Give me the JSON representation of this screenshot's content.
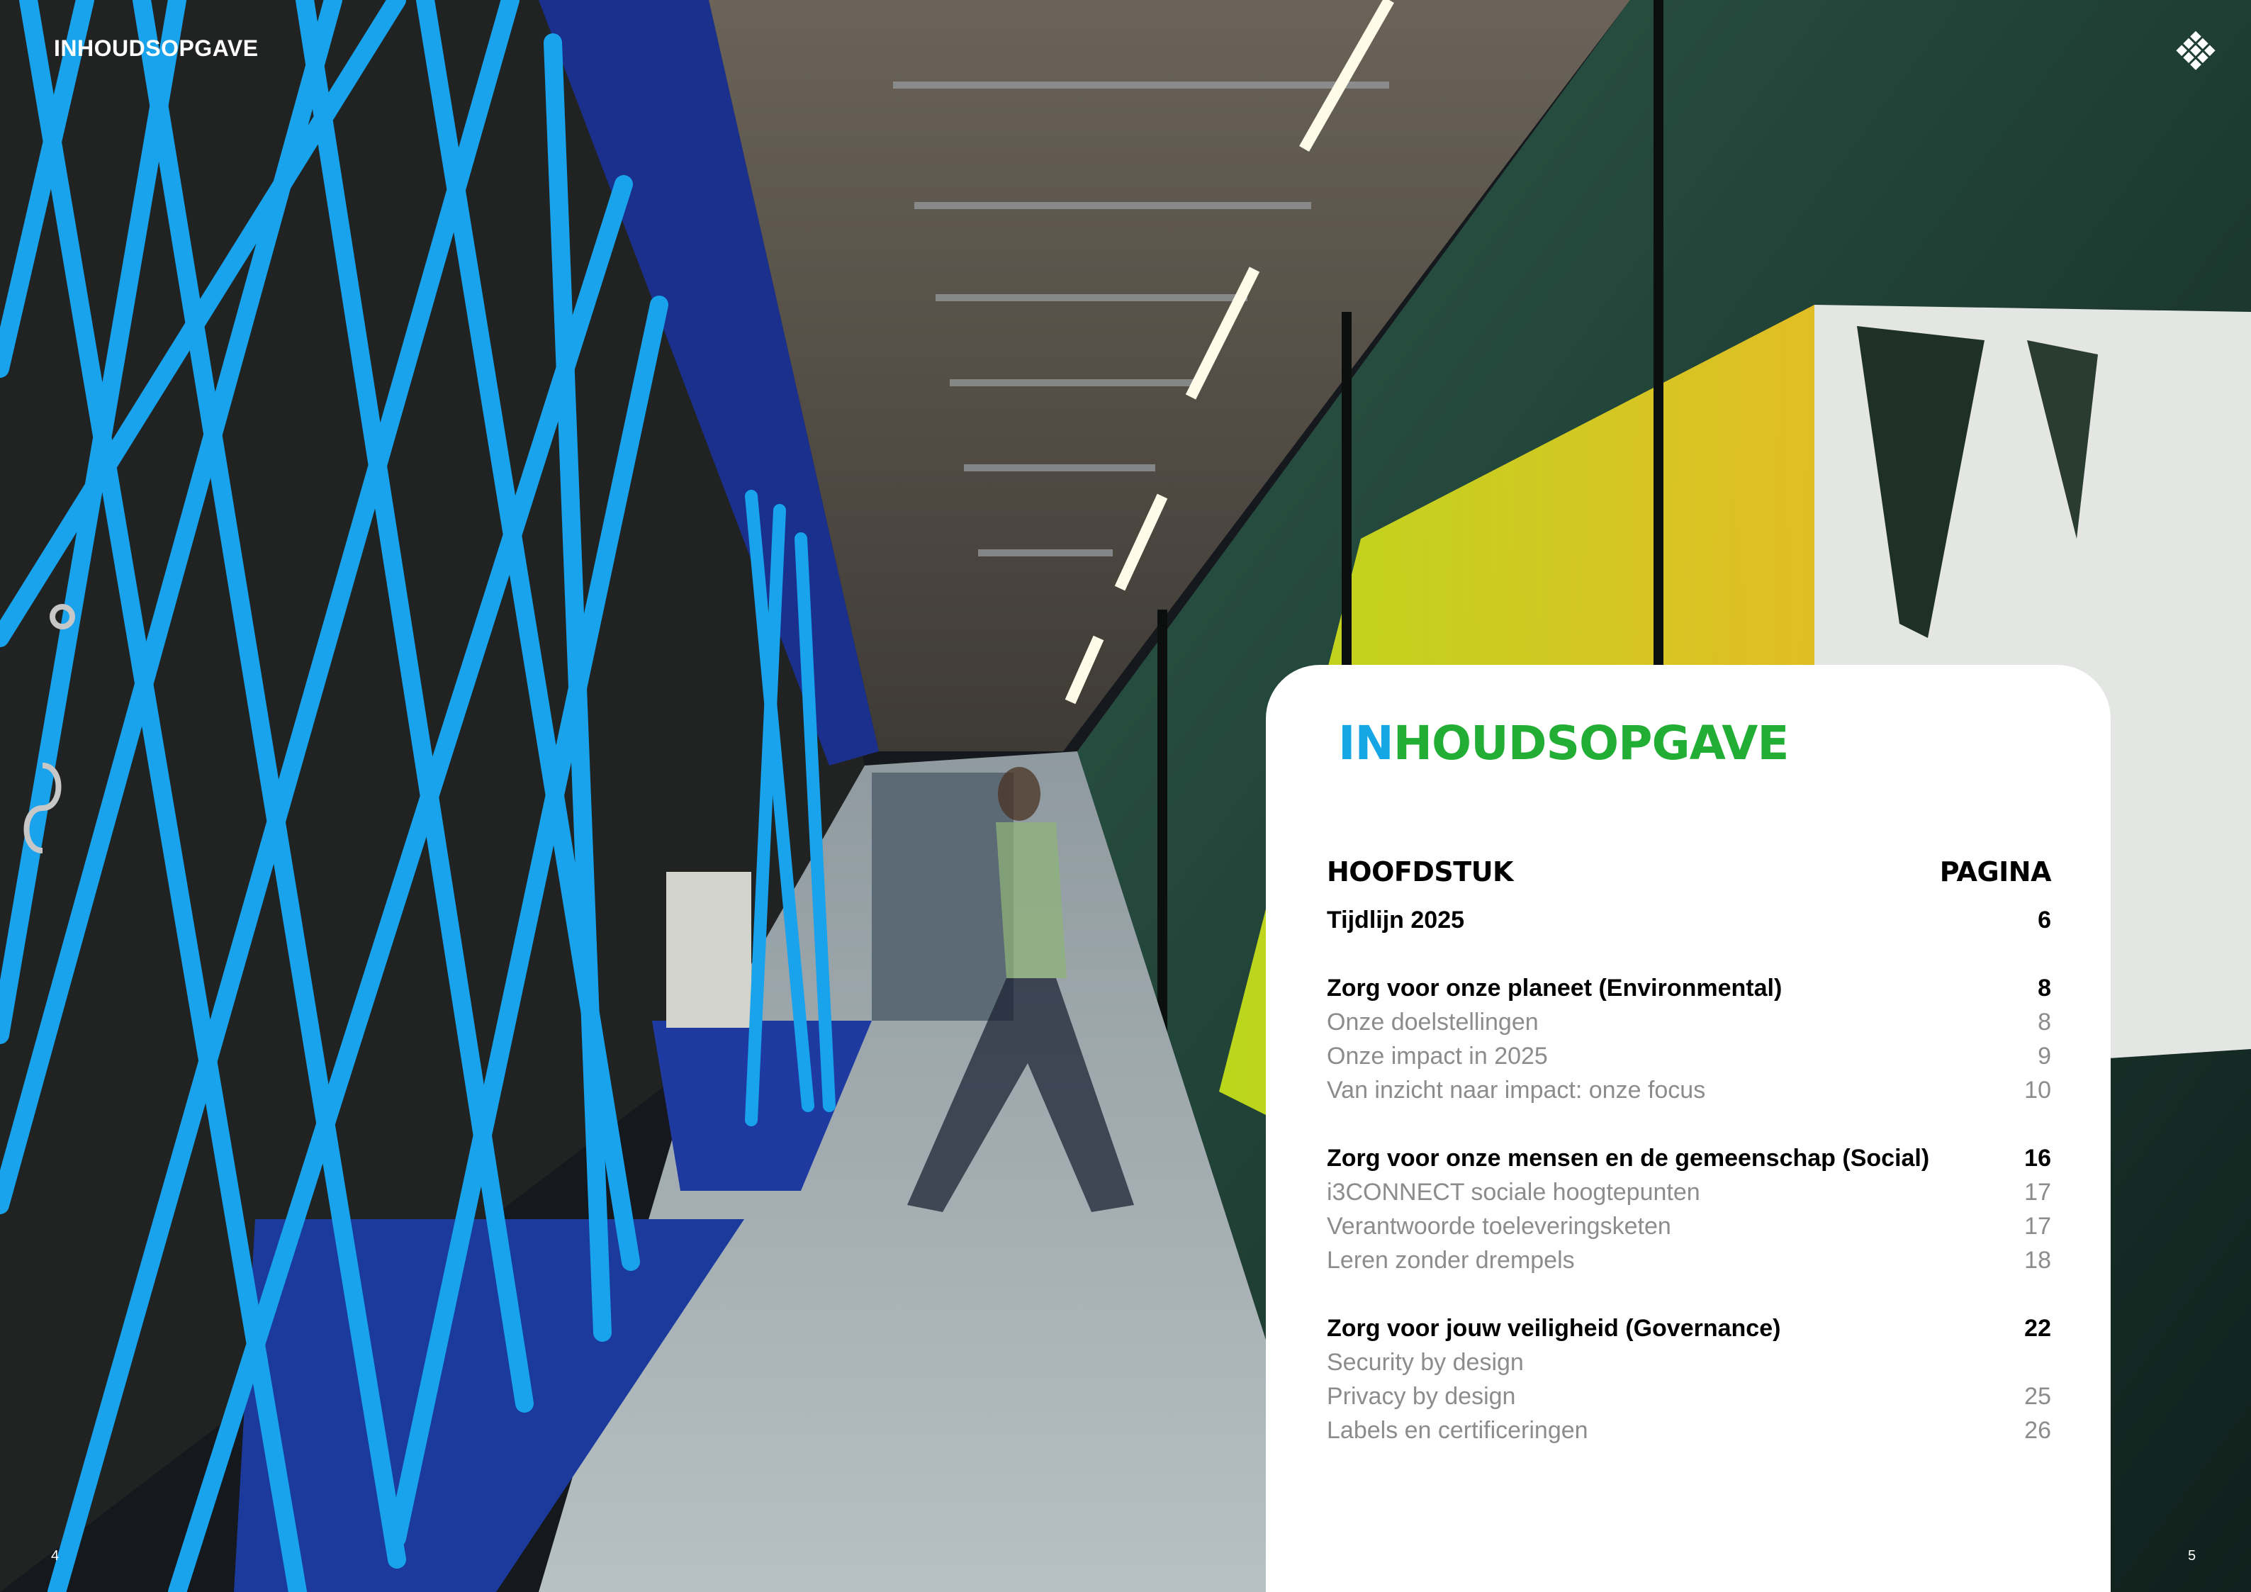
{
  "header": {
    "title": "INHOUDSOPGAVE"
  },
  "footer": {
    "page_left": "4",
    "page_right": "5"
  },
  "logo": {
    "icon": "diamond-grid-logo"
  },
  "toc": {
    "heading_part1": "IN",
    "heading_part2": "HOUDSOPGAVE",
    "col_chapter": "HOOFDSTUK",
    "col_page": "PAGINA",
    "entries": [
      {
        "title": "Tijdlijn 2025",
        "page": "6",
        "level": "main"
      },
      {
        "title": "Zorg voor onze planeet (Environmental)",
        "page": "8",
        "level": "main"
      },
      {
        "title": "Onze doelstellingen",
        "page": "8",
        "level": "sub"
      },
      {
        "title": "Onze impact in 2025",
        "page": "9",
        "level": "sub"
      },
      {
        "title": "Van inzicht naar impact: onze focus",
        "page": "10",
        "level": "sub"
      },
      {
        "title": "Zorg voor onze mensen en de gemeenschap (Social)",
        "page": "16",
        "level": "main"
      },
      {
        "title": "i3CONNECT sociale hoogtepunten",
        "page": "17",
        "level": "sub"
      },
      {
        "title": "Verantwoorde toeleveringsketen",
        "page": "17",
        "level": "sub"
      },
      {
        "title": "Leren zonder drempels",
        "page": "18",
        "level": "sub"
      },
      {
        "title": "Zorg voor jouw veiligheid (Governance)",
        "page": "22",
        "level": "main"
      },
      {
        "title": "Security by design",
        "page": "",
        "level": "sub"
      },
      {
        "title": "Privacy by design",
        "page": "25",
        "level": "sub"
      },
      {
        "title": "Labels en certificeringen",
        "page": "26",
        "level": "sub"
      }
    ]
  }
}
